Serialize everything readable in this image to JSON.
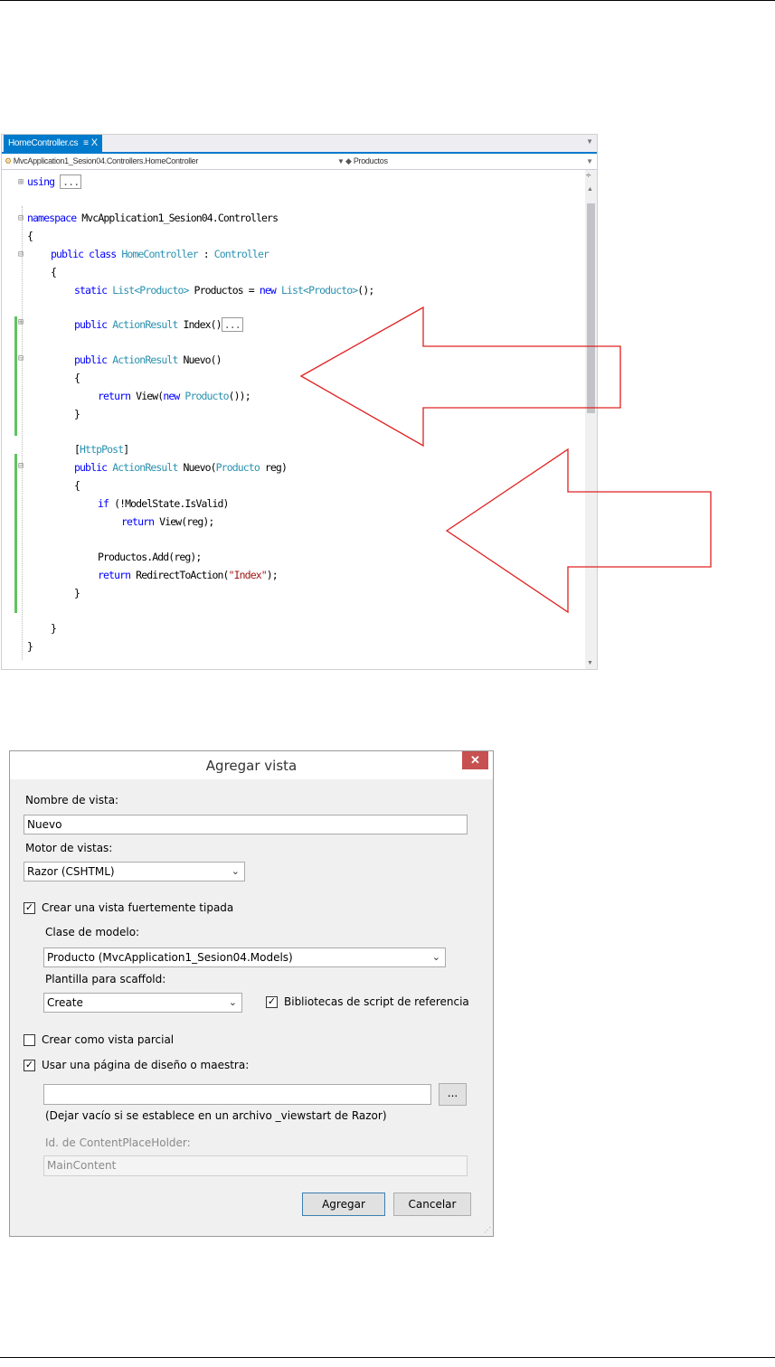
{
  "editor": {
    "tab_label": "HomeController.cs",
    "tab_pin": "≡",
    "tab_close": "X",
    "nav_left": "MvcApplication1_Sesion04.Controllers.HomeController",
    "nav_right": "Productos",
    "collapsed": "...",
    "code": {
      "l1_kw": "using",
      "l2_kw": "namespace",
      "l2_rest": " MvcApplication1_Sesion04.Controllers",
      "brace_open": "{",
      "brace_close": "}",
      "l4_kw": "public class",
      "l4_ty": "HomeController",
      "l4_sep": " : ",
      "l4_base": "Controller",
      "l6_kw": "static",
      "l6_ty1": "List<Producto>",
      "l6_mid": " Productos = ",
      "l6_new": "new",
      "l6_ty2": "List<Producto>",
      "l6_end": "();",
      "public": "public",
      "action_result": "ActionResult",
      "l7_name": " Index()",
      "l8_name": " Nuevo()",
      "return": "return",
      "l10_rest1": " View(",
      "l10_new": "new",
      "l10_ty": "Producto",
      "l10_end": "());",
      "l12_attr": "HttpPost",
      "l13_name": " Nuevo(",
      "l13_ty": "Producto",
      "l13_end": " reg)",
      "l15_if": "if",
      "l15_rest": " (!ModelState.IsValid)",
      "l16_rest": " View(reg);",
      "l17": "Productos.Add(reg);",
      "l18_rest1": " RedirectToAction(",
      "l18_str": "\"Index\"",
      "l18_end": ");"
    }
  },
  "dialog": {
    "title": "Agregar vista",
    "close_symbol": "✕",
    "view_name_label": "Nombre de vista:",
    "view_name_value": "Nuevo",
    "engine_label": "Motor de vistas:",
    "engine_value": "Razor (CSHTML)",
    "strong_typed_label": "Crear una vista fuertemente tipada",
    "strong_typed_checked": true,
    "model_class_label": "Clase de modelo:",
    "model_class_value": "Producto (MvcApplication1_Sesion04.Models)",
    "scaffold_label": "Plantilla para scaffold:",
    "scaffold_value": "Create",
    "script_libs_label": "Bibliotecas de script de referencia",
    "script_libs_checked": true,
    "partial_label": "Crear como vista parcial",
    "partial_checked": false,
    "layout_label": "Usar una página de diseño o maestra:",
    "layout_checked": true,
    "layout_value": "",
    "browse_label": "...",
    "layout_hint": "(Dejar vacío si se establece en un archivo _viewstart de Razor)",
    "placeholder_id_label": "Id. de ContentPlaceHolder:",
    "placeholder_id_value": "MainContent",
    "add_button": "Agregar",
    "cancel_button": "Cancelar"
  },
  "colors": {
    "accent_tab": "#007acc",
    "keyword": "#0000ff",
    "type": "#2b91af",
    "string": "#a31515",
    "arrow": "#e02020",
    "close_button": "#c75050"
  }
}
